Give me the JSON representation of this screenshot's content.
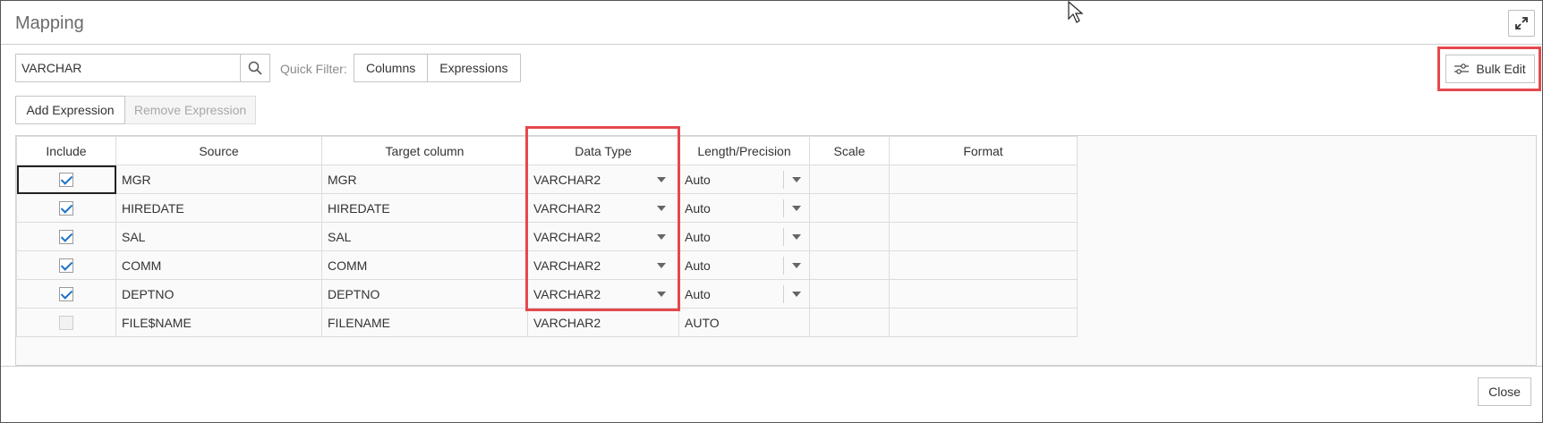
{
  "dialog": {
    "title": "Mapping",
    "close_label": "Close"
  },
  "toolbar": {
    "search_value": "VARCHAR",
    "quick_filter_label": "Quick Filter:",
    "filter_columns": "Columns",
    "filter_expressions": "Expressions",
    "bulk_edit_label": "Bulk Edit",
    "add_expression": "Add Expression",
    "remove_expression": "Remove Expression"
  },
  "grid": {
    "headers": {
      "include": "Include",
      "source": "Source",
      "target": "Target column",
      "data_type": "Data Type",
      "length": "Length/Precision",
      "scale": "Scale",
      "format": "Format"
    },
    "rows": [
      {
        "include": true,
        "source": "MGR",
        "target": "MGR",
        "data_type": "VARCHAR2",
        "length": "Auto",
        "editable": true
      },
      {
        "include": true,
        "source": "HIREDATE",
        "target": "HIREDATE",
        "data_type": "VARCHAR2",
        "length": "Auto",
        "editable": true
      },
      {
        "include": true,
        "source": "SAL",
        "target": "SAL",
        "data_type": "VARCHAR2",
        "length": "Auto",
        "editable": true
      },
      {
        "include": true,
        "source": "COMM",
        "target": "COMM",
        "data_type": "VARCHAR2",
        "length": "Auto",
        "editable": true
      },
      {
        "include": true,
        "source": "DEPTNO",
        "target": "DEPTNO",
        "data_type": "VARCHAR2",
        "length": "Auto",
        "editable": true
      },
      {
        "include": false,
        "source": "FILE$NAME",
        "target": "FILENAME",
        "data_type": "VARCHAR2",
        "length": "AUTO",
        "editable": false
      }
    ]
  },
  "colors": {
    "highlight": "#e5484d",
    "check": "#1a73c7"
  },
  "icons": {
    "search": "search-icon",
    "maximize": "maximize-icon",
    "bulk_edit": "sliders-icon",
    "cursor": "mouse-pointer-icon"
  }
}
